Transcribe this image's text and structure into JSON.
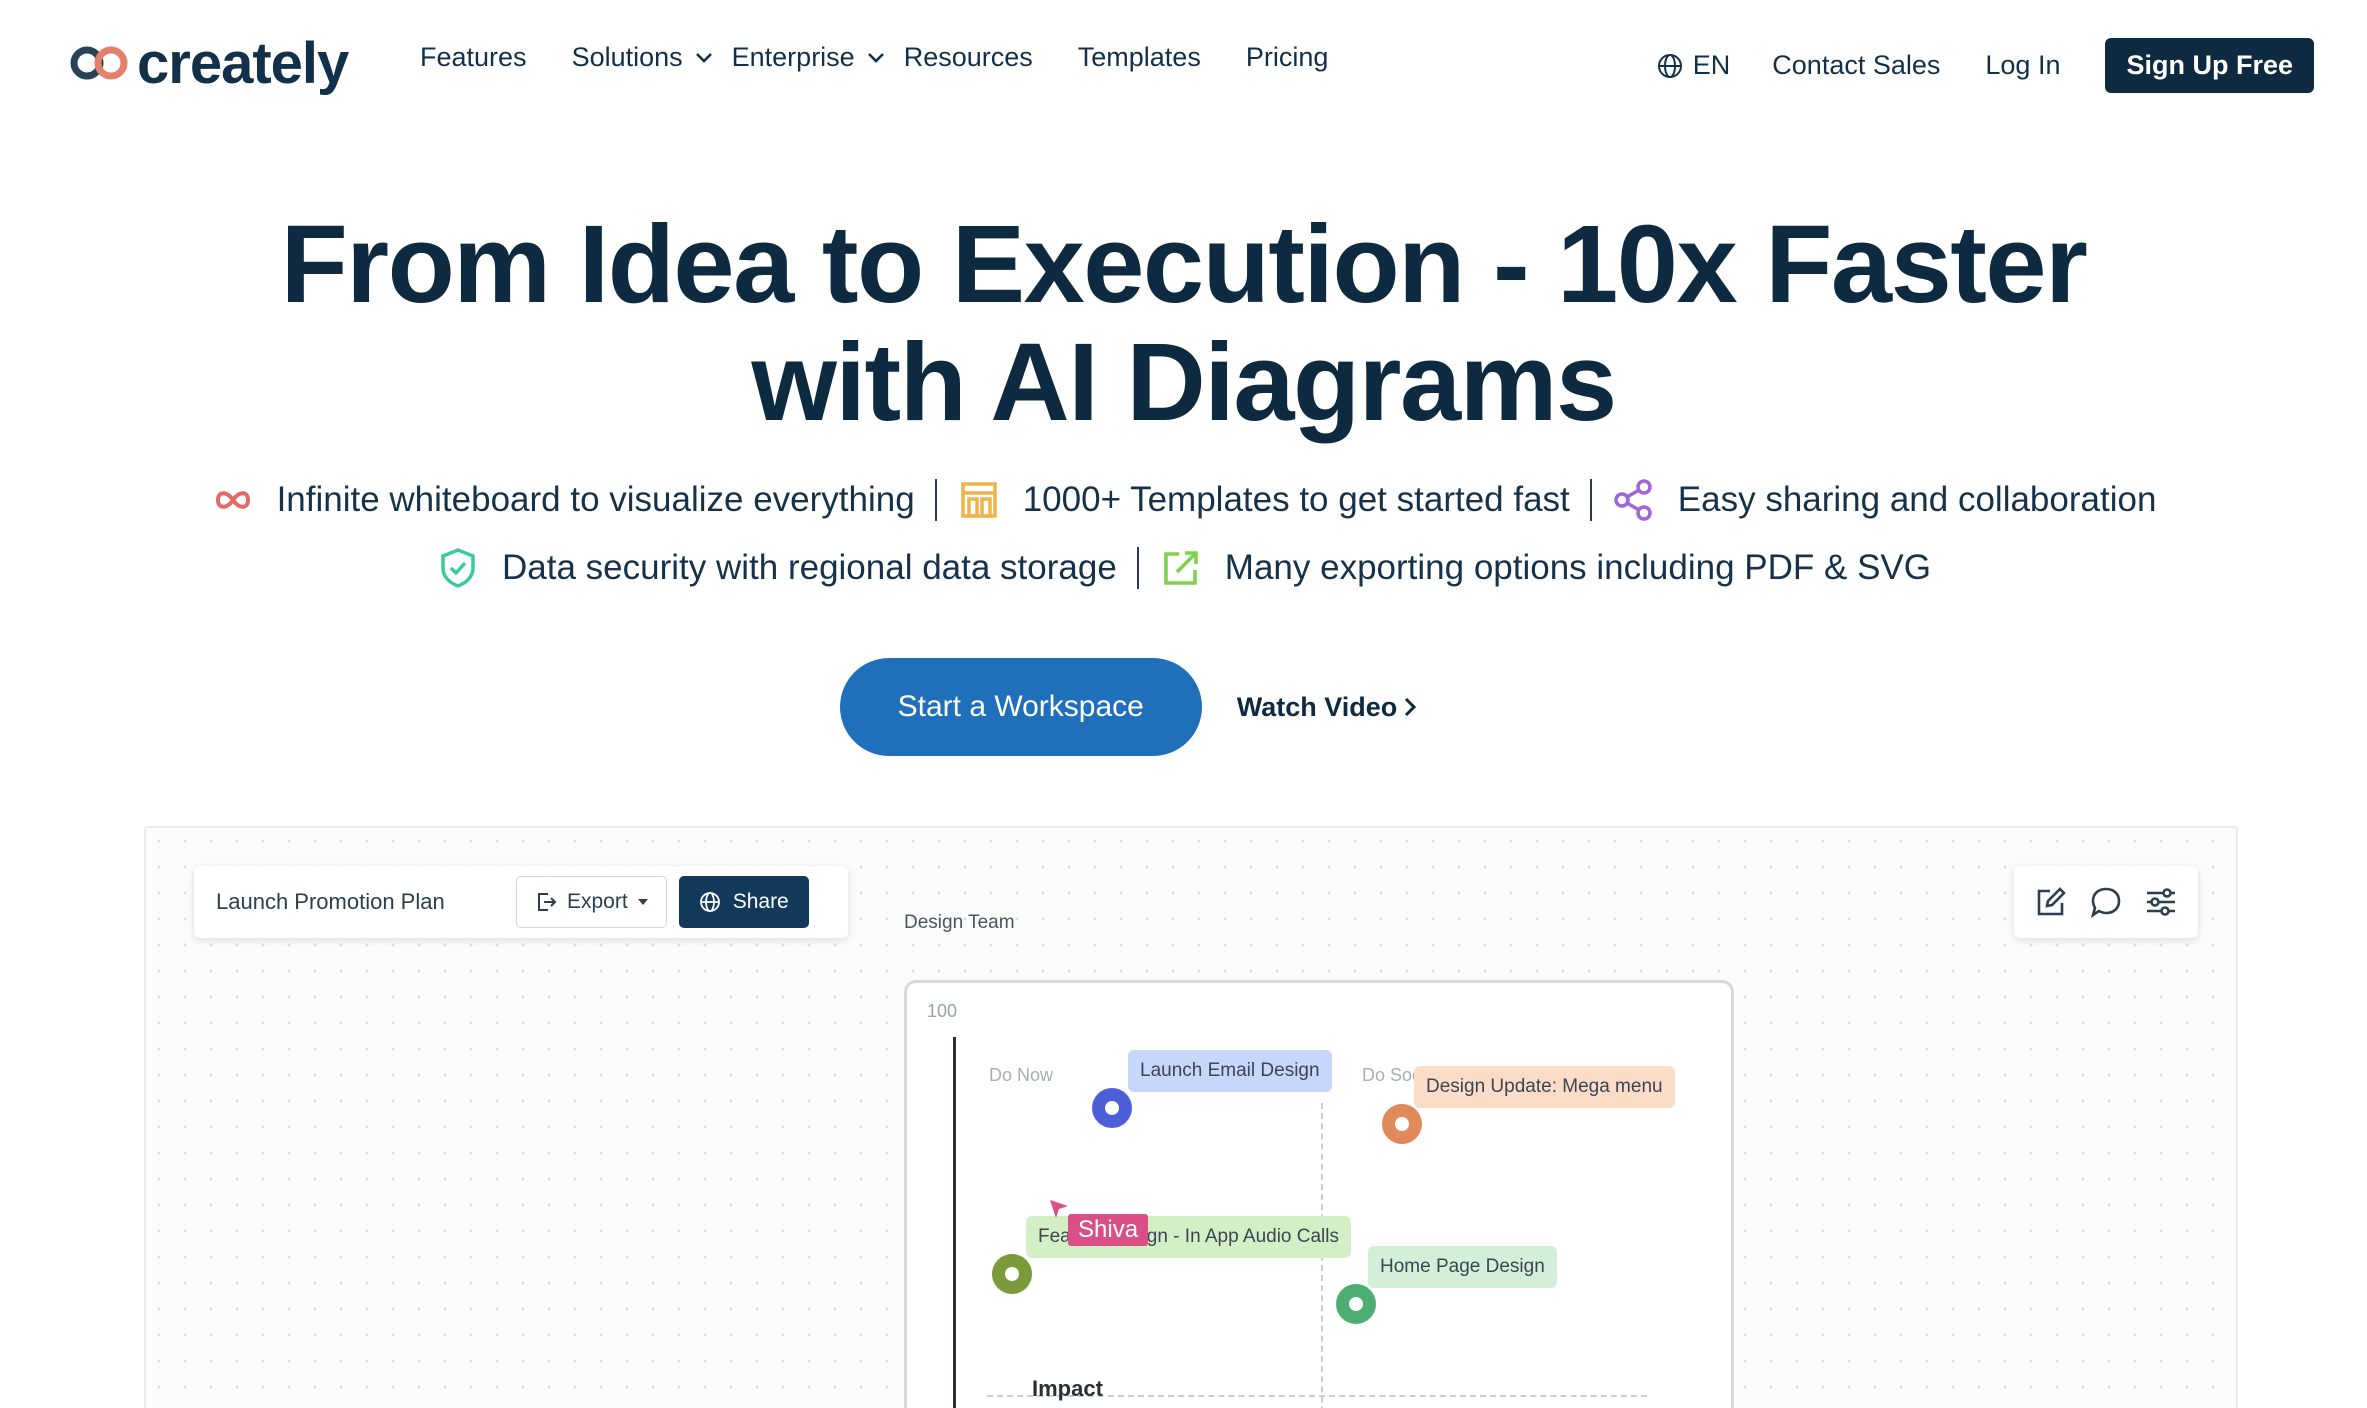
{
  "nav": {
    "logo_text": "creately",
    "links": [
      {
        "label": "Features"
      },
      {
        "label": "Solutions"
      },
      {
        "label": "Enterprise"
      },
      {
        "label": "Resources"
      },
      {
        "label": "Templates"
      },
      {
        "label": "Pricing"
      }
    ],
    "lang": "EN",
    "contact": "Contact Sales",
    "login": "Log In",
    "signup": "Sign Up Free"
  },
  "hero": {
    "title_line1": "From Idea to Execution - 10x Faster",
    "title_line2": "with AI Diagrams",
    "features_row1": [
      "Infinite whiteboard to visualize everything",
      "1000+ Templates to get started fast",
      "Easy sharing and collaboration"
    ],
    "features_row2": [
      "Data security with regional data storage",
      "Many exporting options including PDF & SVG"
    ],
    "cta": "Start a Workspace",
    "watch": "Watch Video"
  },
  "app": {
    "doc_title": "Launch Promotion Plan",
    "export": "Export",
    "share": "Share",
    "team_label": "Design Team",
    "axis_top": "100",
    "quadrant_do_now": "Do Now",
    "quadrant_do_soon": "Do Soo",
    "axis_label": "Impact",
    "tasks": [
      "Launch Email Design",
      "Design Update: Mega menu",
      "Feature Design - In App Audio Calls",
      "Home Page Design"
    ],
    "collaborator": "Shiva",
    "colors": {
      "blue": "#4a5fd8",
      "orange": "#e08a5c",
      "olive": "#7a9a3c",
      "green": "#4cae72",
      "accent": "#1f6fba",
      "navy": "#0d2a40"
    }
  }
}
